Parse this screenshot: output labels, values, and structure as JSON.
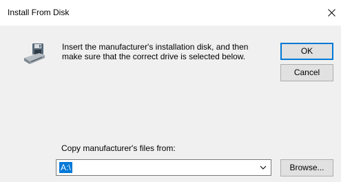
{
  "window": {
    "title": "Install From Disk"
  },
  "message": {
    "line1": "Insert the manufacturer's installation disk, and then",
    "line2": "make sure that the correct drive is selected below."
  },
  "buttons": {
    "ok_label": "OK",
    "cancel_label": "Cancel",
    "browse_label": "Browse..."
  },
  "copy_from": {
    "label": "Copy manufacturer's files from:",
    "value": "A:\\"
  },
  "icons": {
    "close": "close-icon",
    "disk": "disk-drive-icon",
    "dropdown": "chevron-down-icon"
  },
  "colors": {
    "accent": "#0078d7",
    "dialog_bg": "#f0f0f0",
    "button_bg": "#e1e1e1"
  }
}
